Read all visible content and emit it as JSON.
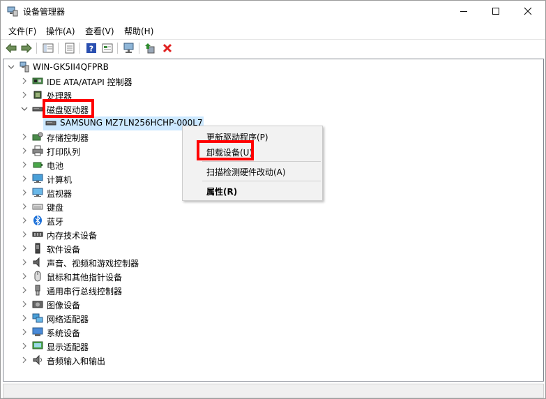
{
  "window": {
    "title": "设备管理器",
    "minimize_icon": "minimize-icon",
    "maximize_icon": "maximize-icon",
    "close_icon": "close-icon"
  },
  "menu": [
    {
      "label": "文件(F)"
    },
    {
      "label": "操作(A)"
    },
    {
      "label": "查看(V)"
    },
    {
      "label": "帮助(H)"
    }
  ],
  "toolbar": {
    "icons": [
      "back-arrow-icon",
      "forward-arrow-icon",
      "properties-icon",
      "list-icon",
      "help-icon",
      "view-icon",
      "monitor-scan-icon",
      "update-driver-icon",
      "uninstall-x-icon"
    ],
    "colors": {
      "back": "#4a7a3a",
      "help": "#2a4fb0",
      "uninstall": "#e02020",
      "update": "#2e8b2e"
    }
  },
  "tree": {
    "root": {
      "label": "WIN-GK5II4QFPRB",
      "icon": "computer-icon",
      "expanded": true
    },
    "items": [
      {
        "label": "IDE ATA/ATAPI 控制器",
        "icon": "ide-controller-icon",
        "expanded": false
      },
      {
        "label": "处理器",
        "icon": "processor-icon",
        "expanded": false
      },
      {
        "label": "磁盘驱动器",
        "icon": "disk-drive-icon",
        "expanded": true,
        "children": [
          {
            "label": "SAMSUNG MZ7LN256HCHP-000L7",
            "icon": "disk-icon",
            "selected": true
          }
        ]
      },
      {
        "label": "存储控制器",
        "icon": "storage-controller-icon",
        "expanded": false
      },
      {
        "label": "打印队列",
        "icon": "printer-icon",
        "expanded": false
      },
      {
        "label": "电池",
        "icon": "battery-icon",
        "expanded": false
      },
      {
        "label": "计算机",
        "icon": "computer-monitor-icon",
        "expanded": false
      },
      {
        "label": "监视器",
        "icon": "monitor-icon",
        "expanded": false
      },
      {
        "label": "键盘",
        "icon": "keyboard-icon",
        "expanded": false
      },
      {
        "label": "蓝牙",
        "icon": "bluetooth-icon",
        "expanded": false
      },
      {
        "label": "内存技术设备",
        "icon": "memory-device-icon",
        "expanded": false
      },
      {
        "label": "软件设备",
        "icon": "software-device-icon",
        "expanded": false
      },
      {
        "label": "声音、视频和游戏控制器",
        "icon": "speaker-icon",
        "expanded": false
      },
      {
        "label": "鼠标和其他指针设备",
        "icon": "mouse-icon",
        "expanded": false
      },
      {
        "label": "通用串行总线控制器",
        "icon": "usb-icon",
        "expanded": false
      },
      {
        "label": "图像设备",
        "icon": "camera-icon",
        "expanded": false
      },
      {
        "label": "网络适配器",
        "icon": "network-adapter-icon",
        "expanded": false
      },
      {
        "label": "系统设备",
        "icon": "system-device-icon",
        "expanded": false
      },
      {
        "label": "显示适配器",
        "icon": "display-adapter-icon",
        "expanded": false
      },
      {
        "label": "音频输入和输出",
        "icon": "audio-io-icon",
        "expanded": false
      }
    ]
  },
  "context_menu": {
    "items": [
      {
        "label": "更新驱动程序(P)",
        "bold": false
      },
      {
        "label": "卸载设备(U)",
        "bold": false
      },
      {
        "label": "扫描检测硬件改动(A)",
        "bold": false
      },
      {
        "label": "属性(R)",
        "bold": true
      }
    ]
  },
  "highlight": {
    "color": "#ff0000",
    "targets": [
      "磁盘驱动器",
      "卸载设备(U)"
    ]
  },
  "colors": {
    "selection": "#cce8ff",
    "chevron": "#6d6d6d"
  }
}
